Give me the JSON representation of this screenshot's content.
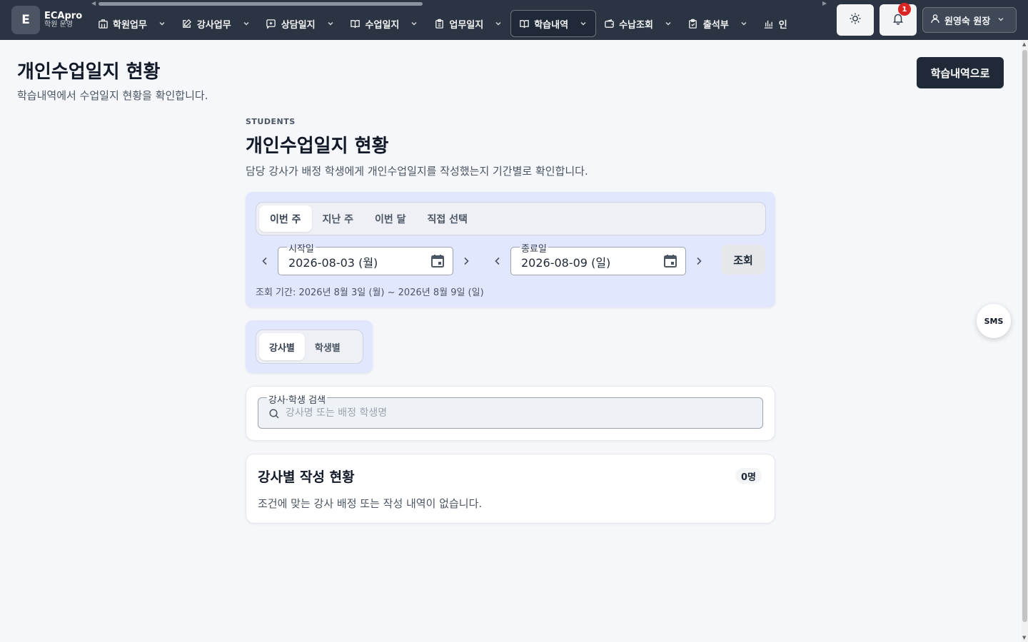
{
  "brand": {
    "logo_letter": "E",
    "name": "ECApro",
    "subtitle": "학원 운영"
  },
  "nav": {
    "items": [
      {
        "label": "학원업무",
        "icon": "building-icon",
        "active": false
      },
      {
        "label": "강사업무",
        "icon": "edit-icon",
        "active": false
      },
      {
        "label": "상담일지",
        "icon": "chat-plus-icon",
        "active": false
      },
      {
        "label": "수업일지",
        "icon": "book-open-icon",
        "active": false
      },
      {
        "label": "업무일지",
        "icon": "clipboard-icon",
        "active": false
      },
      {
        "label": "학습내역",
        "icon": "book-open-icon",
        "active": true
      },
      {
        "label": "수납조회",
        "icon": "wallet-icon",
        "active": false
      },
      {
        "label": "출석부",
        "icon": "clipboard-check-icon",
        "active": false
      },
      {
        "label": "인",
        "icon": "chart-bar-icon",
        "active": false
      }
    ],
    "notification_count": "1",
    "user_label": "원영숙 원장"
  },
  "page": {
    "title": "개인수업일지 현황",
    "subtitle": "학습내역에서 수업일지 현황을 확인합니다.",
    "back_button": "학습내역으로"
  },
  "content": {
    "eyebrow": "STUDENTS",
    "title": "개인수업일지 현황",
    "subtitle": "담당 강사가 배정 학생에게 개인수업일지를 작성했는지 기간별로 확인합니다."
  },
  "period_tabs": [
    {
      "label": "이번 주",
      "active": true
    },
    {
      "label": "지난 주",
      "active": false
    },
    {
      "label": "이번 달",
      "active": false
    },
    {
      "label": "직접 선택",
      "active": false
    }
  ],
  "start_date": {
    "label": "시작일",
    "value": "2026-08-03 (월)"
  },
  "end_date": {
    "label": "종료일",
    "value": "2026-08-09 (일)"
  },
  "query_button": "조회",
  "range_text": "조회 기간: 2026년 8월 3일 (월) ~ 2026년 8월 9일 (일)",
  "view_tabs": [
    {
      "label": "강사별",
      "active": true
    },
    {
      "label": "학생별",
      "active": false
    }
  ],
  "search": {
    "label": "강사·학생 검색",
    "placeholder": "강사명 또는 배정 학생명",
    "value": ""
  },
  "result": {
    "title": "강사별 작성 현황",
    "count": "0명",
    "empty_text": "조건에 맞는 강사 배정 또는 작성 내역이 없습니다."
  },
  "sms_button": "SMS",
  "colors": {
    "topbar": "#2b3442",
    "accent_dark": "#1f2937",
    "panel": "#e0e7ff",
    "badge": "#dc2626"
  }
}
